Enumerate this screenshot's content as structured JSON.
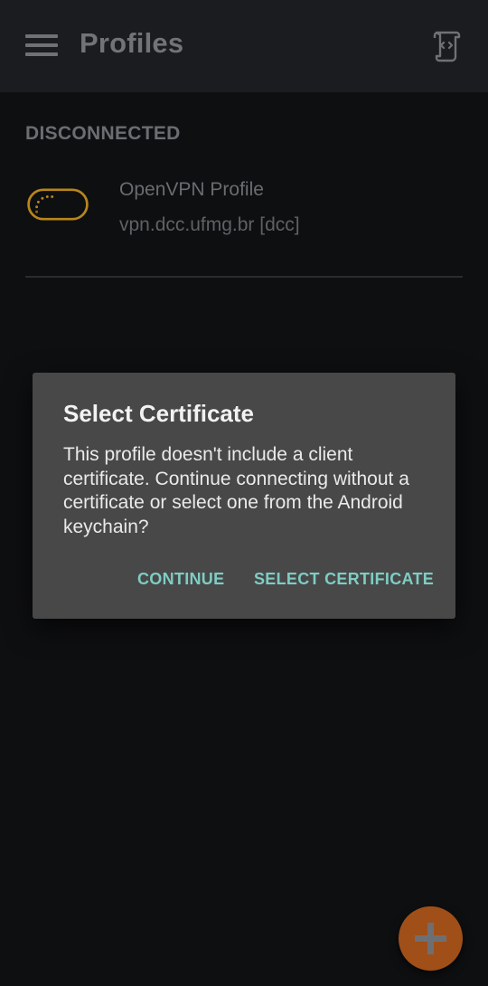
{
  "appbar": {
    "title": "Profiles",
    "menu_icon": "hamburger-menu-icon",
    "action_icon": "script-code-icon"
  },
  "section": {
    "header": "DISCONNECTED"
  },
  "profile": {
    "name": "OpenVPN Profile",
    "server": "vpn.dcc.ufmg.br [dcc]",
    "status_icon": "connecting-pill-icon",
    "status_color": "#b8861b"
  },
  "dialog": {
    "title": "Select Certificate",
    "message": "This profile doesn't include a client certificate. Continue connecting without a certificate or select one from the Android keychain?",
    "continue_label": "CONTINUE",
    "select_label": "SELECT CERTIFICATE",
    "button_color": "#7ecdc4"
  },
  "fab": {
    "icon": "plus-icon",
    "color": "#a04f19"
  }
}
